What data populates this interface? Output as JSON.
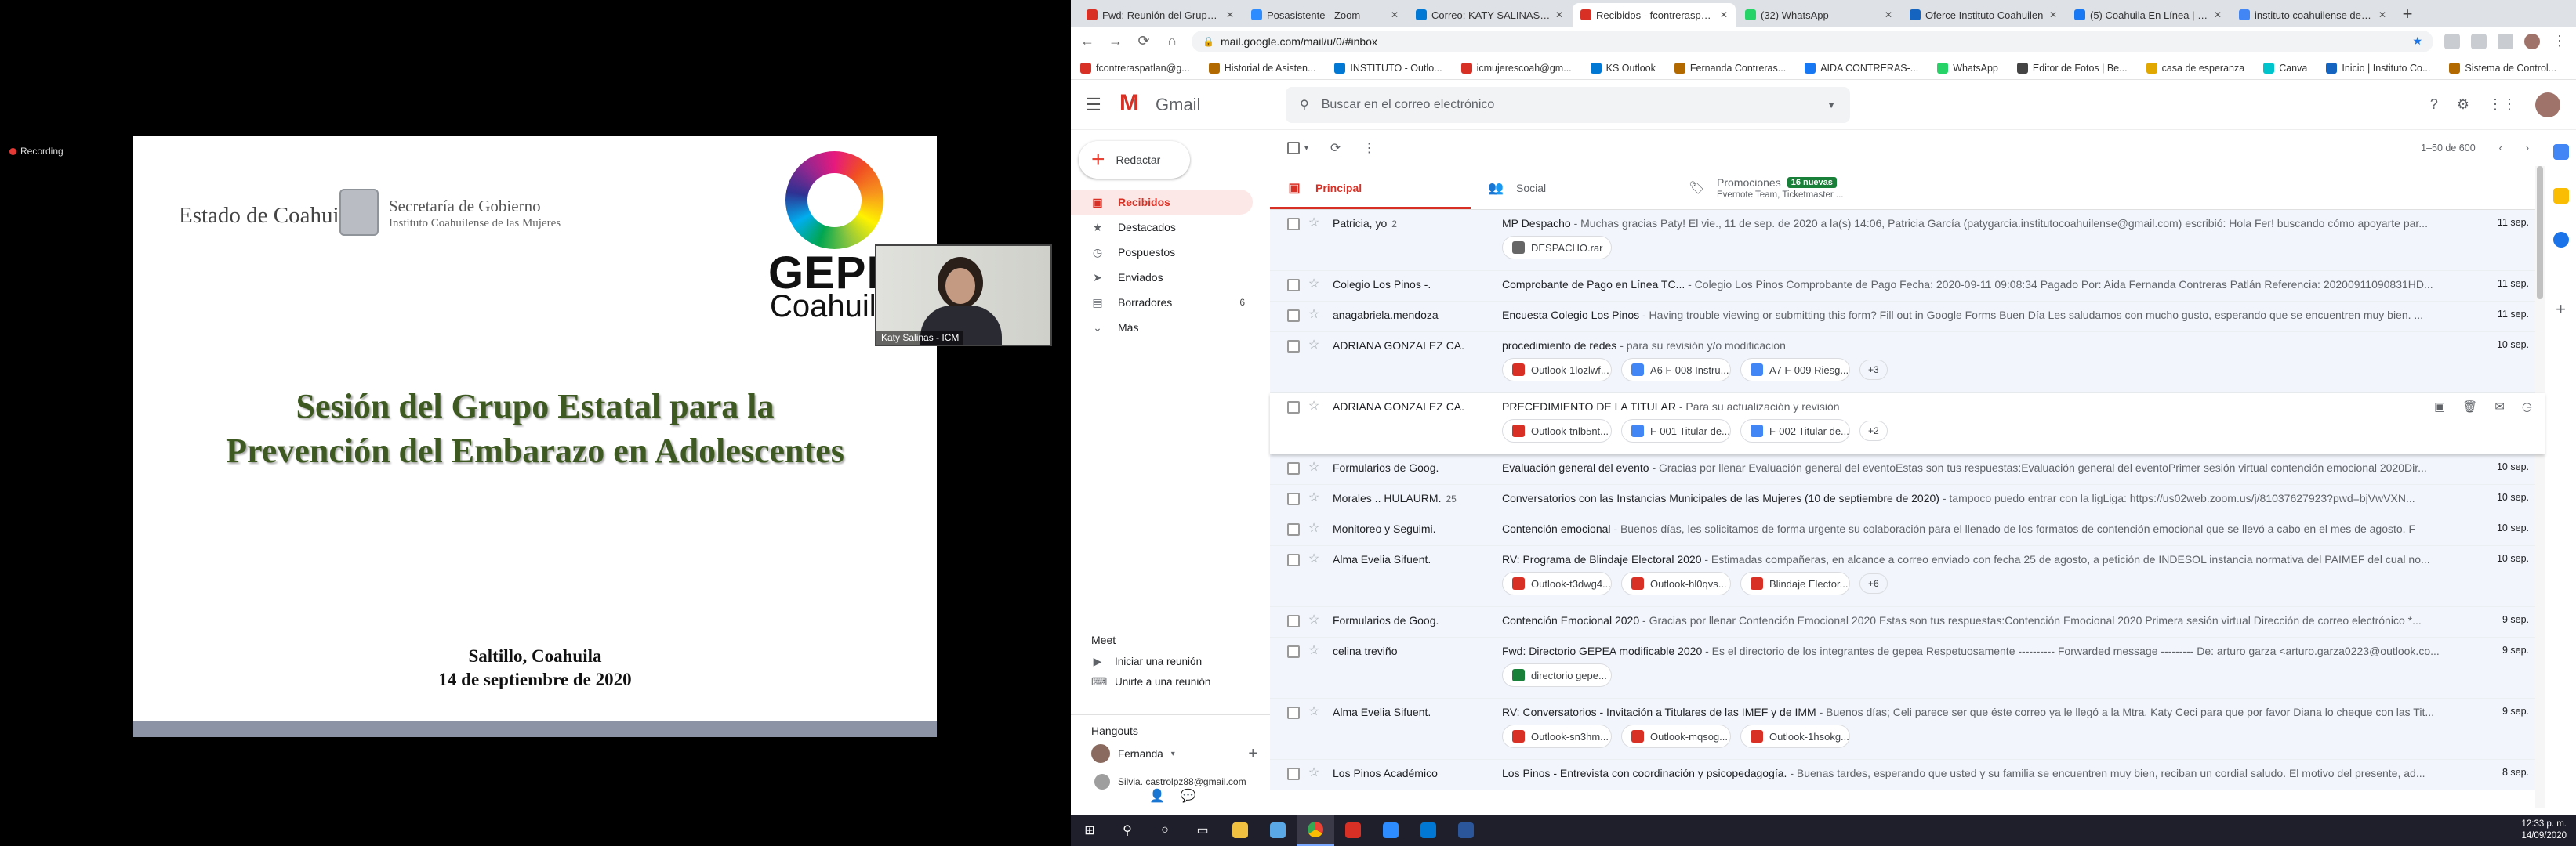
{
  "zoom": {
    "recording": "Recording",
    "slide": {
      "state": "Estado de Coahuila",
      "secretaria": "Secretaría de Gobierno",
      "instituto": "Instituto Coahuilense de las Mujeres",
      "logo_word": "GEPEA",
      "logo_sub": "Coahuila",
      "title1": "Sesión del Grupo Estatal para la",
      "title2": "Prevención del Embarazo en Adolescentes",
      "place": "Saltillo, Coahuila",
      "date": "14 de septiembre de  2020"
    },
    "camera_name": "Katy Salinas - ICM"
  },
  "browser": {
    "tabs": [
      {
        "label": "Fwd: Reunión del Grupo Est",
        "color": "#d93025"
      },
      {
        "label": "Posasistente - Zoom",
        "color": "#2d8cff"
      },
      {
        "label": "Correo: KATY SALINAS PER",
        "color": "#0078d4"
      },
      {
        "label": "Recibidos - fcontreraspatlan",
        "color": "#d93025",
        "active": true
      },
      {
        "label": "(32) WhatsApp",
        "color": "#25d366"
      },
      {
        "label": "Oferce Instituto Coahuilen",
        "color": "#1565c0"
      },
      {
        "label": "(5) Coahuila En Línea | Face",
        "color": "#1877f2"
      },
      {
        "label": "instituto coahuilense de las",
        "color": "#4285f4"
      }
    ],
    "url": "mail.google.com/mail/u/0/#inbox",
    "bookmarks": [
      {
        "label": "fcontreraspatlan@g...",
        "color": "#d93025"
      },
      {
        "label": "Historial de Asisten...",
        "color": "#b26a00"
      },
      {
        "label": "INSTITUTO - Outlo...",
        "color": "#0078d4"
      },
      {
        "label": "icmujerescoah@gm...",
        "color": "#d93025"
      },
      {
        "label": "KS Outlook",
        "color": "#0078d4"
      },
      {
        "label": "Fernanda Contreras...",
        "color": "#b26a00"
      },
      {
        "label": "AIDA CONTRERAS-...",
        "color": "#1877f2"
      },
      {
        "label": "WhatsApp",
        "color": "#25d366"
      },
      {
        "label": "Editor de Fotos | Be...",
        "color": "#444"
      },
      {
        "label": "casa de esperanza",
        "color": "#e0a800"
      },
      {
        "label": "Canva",
        "color": "#00c4cc"
      },
      {
        "label": "Inicio | Instituto Co...",
        "color": "#1565c0"
      },
      {
        "label": "Sistema de Control...",
        "color": "#b26a00"
      }
    ]
  },
  "gmail": {
    "brand": "Gmail",
    "search_placeholder": "Buscar en el correo electrónico",
    "compose": "Redactar",
    "nav": [
      {
        "label": "Recibidos",
        "icon": "▣",
        "selected": true
      },
      {
        "label": "Destacados",
        "icon": "★"
      },
      {
        "label": "Pospuestos",
        "icon": "◷"
      },
      {
        "label": "Enviados",
        "icon": "➤"
      },
      {
        "label": "Borradores",
        "icon": "▤",
        "count": "6"
      },
      {
        "label": "Más",
        "icon": "⌄"
      }
    ],
    "meet": {
      "title": "Meet",
      "items": [
        "Iniciar una reunión",
        "Unirte a una reunión"
      ]
    },
    "hangouts": {
      "title": "Hangouts",
      "user": "Fernanda",
      "contact": "Silvia. castrolpz88@gmail.com"
    },
    "pager": "1–50 de 600",
    "categories": {
      "principal": "Principal",
      "social": "Social",
      "promociones": "Promociones",
      "promo_badge": "16 nuevas",
      "promo_sub": "Evernote Team, Ticketmaster ..."
    },
    "emails": [
      {
        "sender": "Patricia, yo",
        "count": "2",
        "subject": "MP Despacho",
        "snippet": " - Muchas gracias Paty! El vie., 11 de sep. de 2020 a la(s) 14:06, Patricia García (patygarcia.institutocoahuilense@gmail.com) escribió: Hola Fer! buscando cómo apoyarte par...",
        "date": "11 sep.",
        "attachments": [
          {
            "name": "DESPACHO.rar",
            "type": "zip"
          }
        ]
      },
      {
        "sender": "Colegio Los Pinos -.",
        "subject": "Comprobante de Pago en Línea TC...",
        "snippet": " - Colegio Los Pinos Comprobante de Pago Fecha: 2020-09-11 09:08:34 Pagado Por: Aida Fernanda Contreras Patlán Referencia: 20200911090831HD...",
        "date": "11 sep."
      },
      {
        "sender": "anagabriela.mendoza",
        "subject": "Encuesta Colegio Los Pinos",
        "snippet": " - Having trouble viewing or submitting this form? Fill out in Google Forms Buen Día Les saludamos con mucho gusto, esperando que se encuentren muy bien. ...",
        "date": "11 sep."
      },
      {
        "sender": "ADRIANA GONZALEZ CA.",
        "subject": "procedimiento de redes",
        "snippet": " - para su revisión y/o modificacion",
        "date": "10 sep.",
        "attachments": [
          {
            "name": "Outlook-1lozlwf...",
            "type": "pdf"
          },
          {
            "name": "A6 F-008 Instru...",
            "type": "doc"
          },
          {
            "name": "A7 F-009 Riesg...",
            "type": "doc"
          }
        ],
        "more": "+3"
      },
      {
        "sender": "ADRIANA GONZALEZ CA.",
        "subject": "PRECEDIMIENTO DE LA TITULAR",
        "snippet": " - Para su actualización y revisión",
        "date": "",
        "hover": true,
        "attachments": [
          {
            "name": "Outlook-tnlb5nt...",
            "type": "pdf"
          },
          {
            "name": "F-001 Titular de...",
            "type": "doc"
          },
          {
            "name": "F-002 Titular de...",
            "type": "doc"
          }
        ],
        "more": "+2"
      },
      {
        "sender": "Formularios de Goog.",
        "subject": "Evaluación general del evento",
        "snippet": " - Gracias por llenar Evaluación general del eventoEstas son tus respuestas:Evaluación general del eventoPrimer sesión virtual contención emocional 2020Dir...",
        "date": "10 sep."
      },
      {
        "sender": "Morales .. HULAURM.",
        "count": "25",
        "subject": "Conversatorios con las Instancias Municipales de las Mujeres (10 de septiembre de 2020)",
        "snippet": " - tampoco puedo entrar con la ligLiga: https://us02web.zoom.us/j/81037627923?pwd=bjVwVXN...",
        "date": "10 sep."
      },
      {
        "sender": "Monitoreo y Seguimi.",
        "subject": "Contención emocional",
        "snippet": " - Buenos días, les solicitamos de forma urgente su colaboración para el llenado de los formatos de contención emocional que se llevó a cabo en el mes de agosto. F",
        "date": "10 sep."
      },
      {
        "sender": "Alma Evelia Sifuent.",
        "subject": "RV: Programa de Blindaje Electoral 2020",
        "snippet": " - Estimadas compañeras, en alcance a correo enviado con fecha 25 de agosto, a petición de INDESOL instancia normativa del PAIMEF del cual no...",
        "date": "10 sep.",
        "attachments": [
          {
            "name": "Outlook-t3dwg4...",
            "type": "pdf"
          },
          {
            "name": "Outlook-hl0qvs...",
            "type": "pdf"
          },
          {
            "name": "Blindaje Elector...",
            "type": "pdf"
          }
        ],
        "more": "+6"
      },
      {
        "sender": "Formularios de Goog.",
        "subject": "Contención Emocional 2020",
        "snippet": " - Gracias por llenar Contención Emocional 2020 Estas son tus respuestas:Contención Emocional 2020 Primera sesión virtual Dirección de correo electrónico *...",
        "date": "9 sep."
      },
      {
        "sender": "celina treviño",
        "subject": "Fwd: Directorio GEPEA modificable 2020",
        "snippet": " - Es el directorio de los integrantes de gepea Respetuosamente ---------- Forwarded message --------- De: arturo garza <arturo.garza0223@outlook.co...",
        "date": "9 sep.",
        "attachments": [
          {
            "name": "directorio gepe...",
            "type": "xls"
          }
        ]
      },
      {
        "sender": "Alma Evelia Sifuent.",
        "subject": "RV: Conversatorios - Invitación a Titulares de las IMEF y de IMM",
        "snippet": " - Buenos días; Celi parece ser que éste correo ya le llegó a la Mtra. Katy Ceci para que por favor Diana lo cheque con las Tit...",
        "date": "9 sep.",
        "attachments": [
          {
            "name": "Outlook-sn3hm...",
            "type": "pdf"
          },
          {
            "name": "Outlook-mqsog...",
            "type": "pdf"
          },
          {
            "name": "Outlook-1hsokg...",
            "type": "pdf"
          }
        ]
      },
      {
        "sender": "Los Pinos Académico",
        "subject": "Los Pinos - Entrevista con coordinación y psicopedagogía.",
        "snippet": " - Buenas tardes, esperando que usted y su familia se encuentren muy bien, reciban un cordial saludo. El motivo del presente, ad...",
        "date": "8 sep."
      }
    ]
  },
  "taskbar": {
    "time": "12:33 p. m.",
    "date": "14/09/2020"
  }
}
